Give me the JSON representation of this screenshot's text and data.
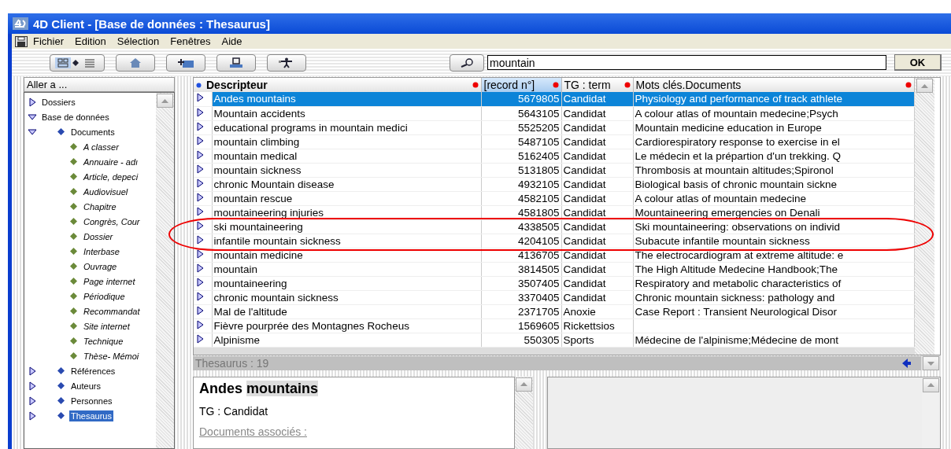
{
  "window": {
    "title": "4D Client - [Base de données : Thesaurus]"
  },
  "menu": [
    "Fichier",
    "Edition",
    "Sélection",
    "Fenêtres",
    "Aide"
  ],
  "search": {
    "value": "mountain",
    "button": "OK"
  },
  "sidebar": {
    "header": "Aller a ...",
    "items": [
      {
        "label": "Dossiers",
        "kind": "group",
        "expanded": false,
        "selected": false
      },
      {
        "label": "Base de données",
        "kind": "group",
        "expanded": true,
        "selected": false,
        "children": [
          {
            "label": "Documents",
            "kind": "table",
            "expanded": true,
            "selected": false,
            "children": [
              {
                "label": "A classer",
                "kind": "subset",
                "selected": false
              },
              {
                "label": "Annuaire - adı",
                "kind": "subset",
                "selected": false
              },
              {
                "label": "Article, depeci",
                "kind": "subset",
                "selected": false
              },
              {
                "label": "Audiovisuel",
                "kind": "subset",
                "selected": false
              },
              {
                "label": "Chapitre",
                "kind": "subset",
                "selected": false
              },
              {
                "label": "Congrès, Cour",
                "kind": "subset",
                "selected": false
              },
              {
                "label": "Dossier",
                "kind": "subset",
                "selected": false
              },
              {
                "label": "Interbase",
                "kind": "subset",
                "selected": false
              },
              {
                "label": "Ouvrage",
                "kind": "subset",
                "selected": false
              },
              {
                "label": "Page internet",
                "kind": "subset",
                "selected": false
              },
              {
                "label": "Périodique",
                "kind": "subset",
                "selected": false
              },
              {
                "label": "Recommandat",
                "kind": "subset",
                "selected": false
              },
              {
                "label": "Site internet",
                "kind": "subset",
                "selected": false
              },
              {
                "label": "Technique",
                "kind": "subset",
                "selected": false
              },
              {
                "label": "Thèse- Mémoi",
                "kind": "subset",
                "selected": false
              }
            ]
          },
          {
            "label": "Références",
            "kind": "table",
            "expanded": false,
            "selected": false
          },
          {
            "label": "Auteurs",
            "kind": "table",
            "expanded": false,
            "selected": false
          },
          {
            "label": "Personnes",
            "kind": "table",
            "expanded": false,
            "selected": false
          },
          {
            "label": "Thesaurus",
            "kind": "table",
            "expanded": false,
            "selected": true
          }
        ]
      }
    ]
  },
  "table": {
    "columns": [
      {
        "label": "Descripteur",
        "sorted": true,
        "selected": false
      },
      {
        "label": "[record n°]",
        "sorted": false,
        "selected": true
      },
      {
        "label": "TG : term",
        "sorted": false,
        "selected": false
      },
      {
        "label": "Mots clés.Documents",
        "sorted": false,
        "selected": false
      }
    ],
    "rows": [
      {
        "descripteur": "Andes mountains",
        "record": "5679805",
        "tg": "Candidat",
        "documents": "Physiology and performance of track athlete",
        "selected": true
      },
      {
        "descripteur": "Mountain accidents",
        "record": "5643105",
        "tg": "Candidat",
        "documents": "A colour atlas of mountain medecine;Psych",
        "selected": false
      },
      {
        "descripteur": "educational programs in mountain medici",
        "record": "5525205",
        "tg": "Candidat",
        "documents": "Mountain medicine education in Europe",
        "selected": false
      },
      {
        "descripteur": "mountain climbing",
        "record": "5487105",
        "tg": "Candidat",
        "documents": "Cardiorespiratory response to exercise in el",
        "selected": false
      },
      {
        "descripteur": "mountain medical",
        "record": "5162405",
        "tg": "Candidat",
        "documents": "Le médecin et la prépartion d'un trekking. Q",
        "selected": false
      },
      {
        "descripteur": "mountain sickness",
        "record": "5131805",
        "tg": "Candidat",
        "documents": "Thrombosis at mountain altitudes;Spironol",
        "selected": false
      },
      {
        "descripteur": "chronic Mountain disease",
        "record": "4932105",
        "tg": "Candidat",
        "documents": "Biological basis of chronic mountain sickne",
        "selected": false
      },
      {
        "descripteur": "mountain rescue",
        "record": "4582105",
        "tg": "Candidat",
        "documents": "A colour atlas of mountain medecine",
        "selected": false
      },
      {
        "descripteur": "mountaineering injuries",
        "record": "4581805",
        "tg": "Candidat",
        "documents": "Mountaineering emergencies on Denali",
        "selected": false
      },
      {
        "descripteur": "ski mountaineering",
        "record": "4338505",
        "tg": "Candidat",
        "documents": "Ski mountaineering: observations on individ",
        "selected": false
      },
      {
        "descripteur": "infantile mountain sickness",
        "record": "4204105",
        "tg": "Candidat",
        "documents": "Subacute infantile mountain sickness",
        "selected": false
      },
      {
        "descripteur": "mountain medicine",
        "record": "4136705",
        "tg": "Candidat",
        "documents": "The electrocardiogram at extreme altitude: e",
        "selected": false
      },
      {
        "descripteur": "mountain",
        "record": "3814505",
        "tg": "Candidat",
        "documents": "The High Altitude Medecine Handbook;The",
        "selected": false
      },
      {
        "descripteur": "mountaineering",
        "record": "3507405",
        "tg": "Candidat",
        "documents": "Respiratory and metabolic characteristics of",
        "selected": false
      },
      {
        "descripteur": "chronic mountain sickness",
        "record": "3370405",
        "tg": "Candidat",
        "documents": "Chronic mountain sickness: pathology and",
        "selected": false
      },
      {
        "descripteur": "Mal de l'altitude",
        "record": "2371705",
        "tg": "Anoxie",
        "documents": "Case Report : Transient Neurological Disor",
        "selected": false
      },
      {
        "descripteur": "Fièvre pourprée des Montagnes Rocheus",
        "record": "1569605",
        "tg": "Rickettsios",
        "selected": false
      },
      {
        "descripteur": "Alpinisme",
        "record": "550305",
        "tg": "Sports",
        "documents": "Médecine de l'alpinisme;Médecine de mont",
        "selected": false
      }
    ],
    "status": "Thesaurus : 19"
  },
  "detail": {
    "title": "Andes",
    "title_match": "mountains",
    "tg": "TG : Candidat",
    "documents_label": "Documents associés :"
  }
}
